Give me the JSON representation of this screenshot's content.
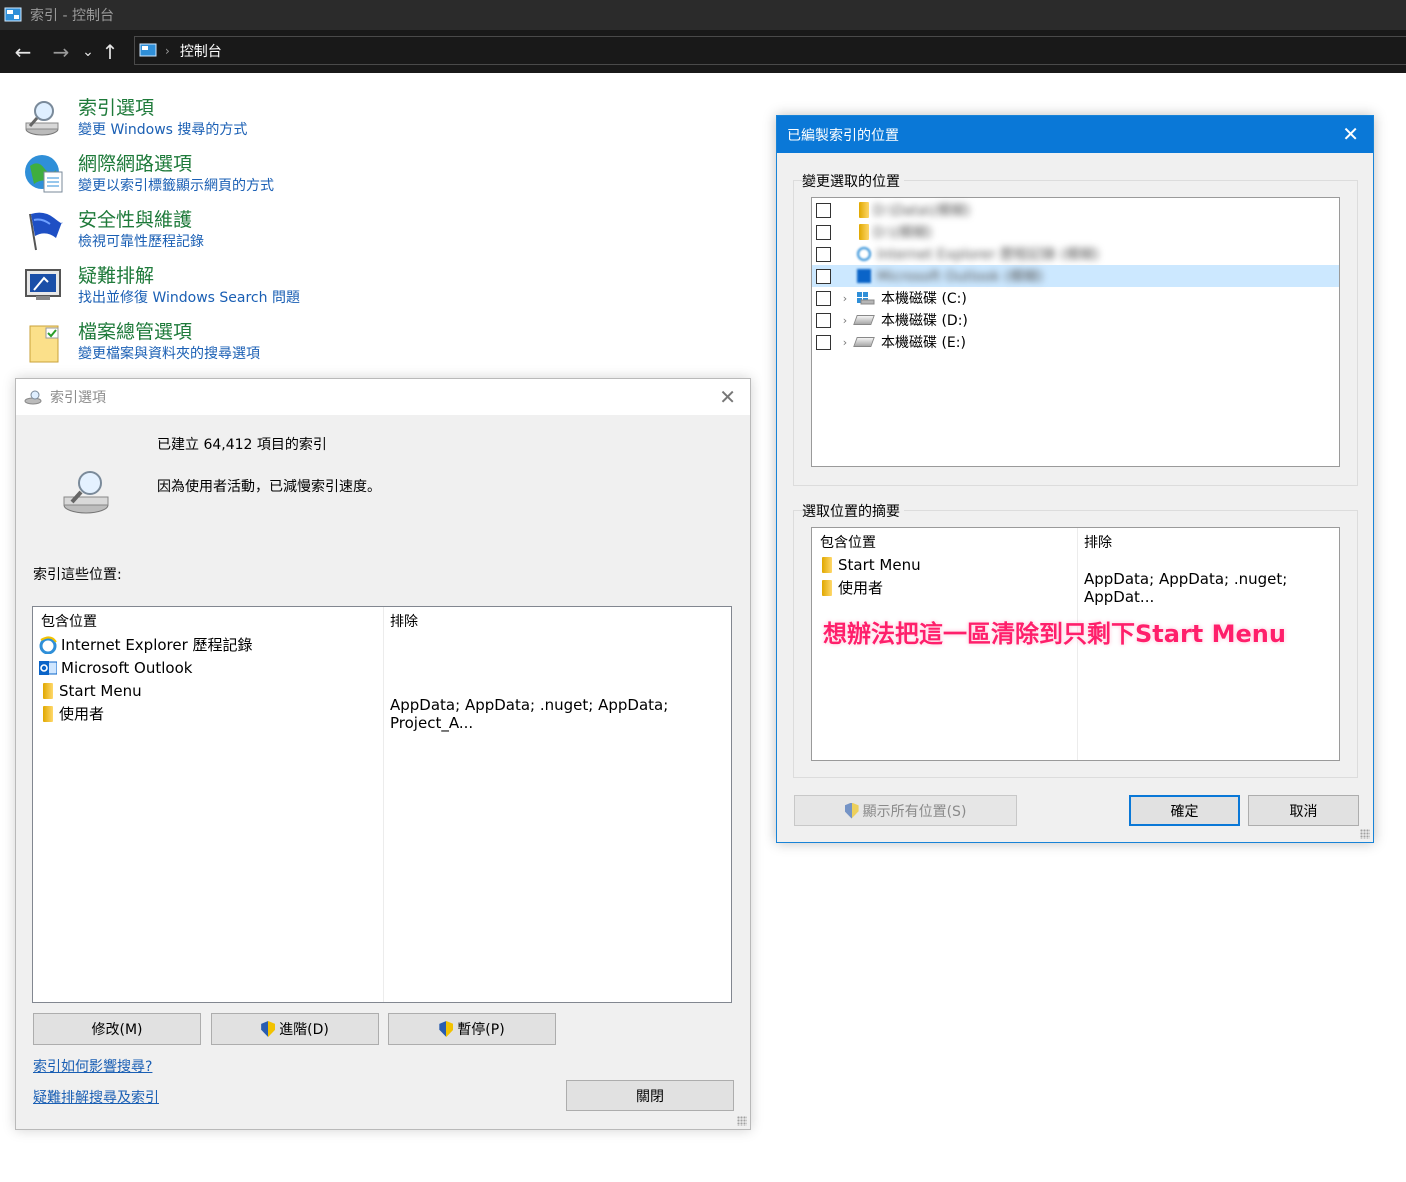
{
  "window": {
    "title": "索引 - 控制台",
    "breadcrumb": "控制台"
  },
  "control_panel_items": [
    {
      "title": "索引選項",
      "subtitle": "變更 Windows 搜尋的方式",
      "icon": "indexing-options-icon"
    },
    {
      "title": "網際網路選項",
      "subtitle": "變更以索引標籤顯示網頁的方式",
      "icon": "internet-options-globe-icon"
    },
    {
      "title": "安全性與維護",
      "subtitle": "檢視可靠性歷程記錄",
      "icon": "security-flag-icon"
    },
    {
      "title": "疑難排解",
      "subtitle": "找出並修復 Windows Search 問題",
      "icon": "troubleshooting-icon"
    },
    {
      "title": "檔案總管選項",
      "subtitle": "變更檔案與資料夾的搜尋選項",
      "icon": "file-explorer-options-icon"
    }
  ],
  "indexing_dialog": {
    "title": "索引選項",
    "status_count": "已建立 64,412 項目的索引",
    "status_message": "因為使用者活動，已減慢索引速度。",
    "locations_label": "索引這些位置:",
    "col_included": "包含位置",
    "col_exclude": "排除",
    "rows": [
      {
        "name": "Internet Explorer 歷程記錄",
        "exclude": ""
      },
      {
        "name": "Microsoft Outlook",
        "exclude": ""
      },
      {
        "name": "Start Menu",
        "exclude": ""
      },
      {
        "name": "使用者",
        "exclude": "AppData; AppData; .nuget; AppData; Project_A..."
      }
    ],
    "modify_button": "修改(M)",
    "advanced_button": "進階(D)",
    "pause_button": "暫停(P)",
    "link_how": "索引如何影響搜尋?",
    "link_troubleshoot": "疑難排解搜尋及索引",
    "close_button": "關閉"
  },
  "locations_dialog": {
    "title": "已編製索引的位置",
    "change_group_label": "變更選取的位置",
    "tree": [
      {
        "label": "D:\\Data\\(模糊)",
        "blurred": true
      },
      {
        "label": "D:\\(模糊)",
        "blurred": true
      },
      {
        "label": "Internet Explorer 歷程記錄 (模糊)",
        "blurred": true
      },
      {
        "label": "Microsoft Outlook (模糊)",
        "blurred": true
      },
      {
        "label": "本機磁碟 (C:)",
        "blurred": false
      },
      {
        "label": "本機磁碟 (D:)",
        "blurred": false
      },
      {
        "label": "本機磁碟 (E:)",
        "blurred": false
      }
    ],
    "summary_group_label": "選取位置的摘要",
    "col_included": "包含位置",
    "col_exclude": "排除",
    "summary_rows": [
      {
        "name": "Start Menu",
        "exclude": ""
      },
      {
        "name": "使用者",
        "exclude": "AppData; AppData; .nuget; AppDat..."
      }
    ],
    "annotation": "想辦法把這一區清除到只剩下Start Menu",
    "show_all_button": "顯示所有位置(S)",
    "ok_button": "確定",
    "cancel_button": "取消"
  },
  "colors": {
    "link_green": "#1e7a3a",
    "link_blue": "#1a5fb4",
    "titlebar_blue": "#0a78d7",
    "annotation_pink": "#ff1f6b"
  }
}
